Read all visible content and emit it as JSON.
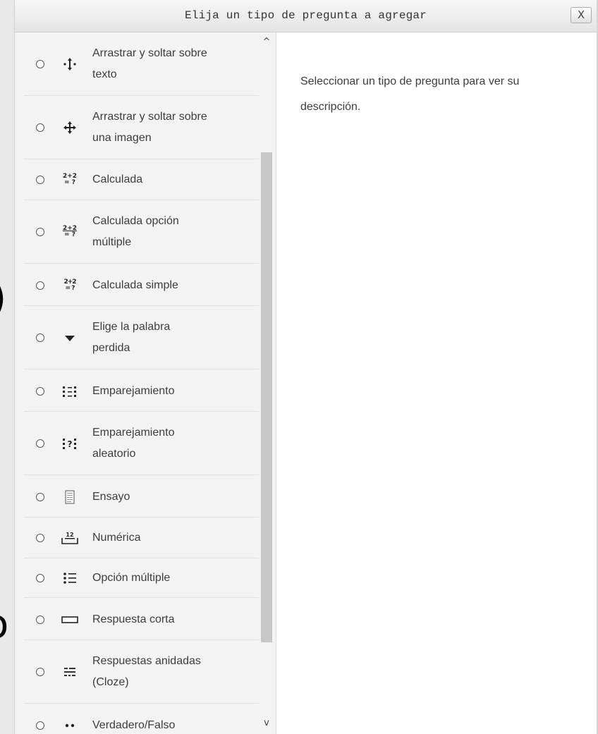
{
  "dialog": {
    "title": "Elija un tipo de pregunta a agregar",
    "close_label": "X"
  },
  "background_fragments": {
    "paren": ")",
    "letter": "o"
  },
  "question_types": [
    {
      "label_line1": "Arrastrar y soltar sobre",
      "label_line2": "texto",
      "icon": "drag-drop-text-icon"
    },
    {
      "label_line1": "Arrastrar y soltar sobre",
      "label_line2": "una imagen",
      "icon": "drag-drop-image-icon"
    },
    {
      "label_line1": "Calculada",
      "label_line2": "",
      "icon": "calculated-icon"
    },
    {
      "label_line1": "Calculada opción",
      "label_line2": "múltiple",
      "icon": "calculated-multichoice-icon"
    },
    {
      "label_line1": "Calculada simple",
      "label_line2": "",
      "icon": "calculated-simple-icon"
    },
    {
      "label_line1": "Elige la palabra",
      "label_line2": "perdida",
      "icon": "dropdown-triangle-icon"
    },
    {
      "label_line1": "Emparejamiento",
      "label_line2": "",
      "icon": "matching-icon"
    },
    {
      "label_line1": "Emparejamiento",
      "label_line2": "aleatorio",
      "icon": "random-matching-icon"
    },
    {
      "label_line1": "Ensayo",
      "label_line2": "",
      "icon": "essay-icon"
    },
    {
      "label_line1": "Numérica",
      "label_line2": "",
      "icon": "numerical-icon"
    },
    {
      "label_line1": "Opción múltiple",
      "label_line2": "",
      "icon": "multichoice-icon"
    },
    {
      "label_line1": "Respuesta corta",
      "label_line2": "",
      "icon": "short-answer-icon"
    },
    {
      "label_line1": "Respuestas anidadas",
      "label_line2": "(Cloze)",
      "icon": "cloze-icon"
    },
    {
      "label_line1": "Verdadero/Falso",
      "label_line2": "",
      "icon": "true-false-icon"
    }
  ],
  "icon_text": {
    "calc_top": "2+2",
    "calc_bottom": "= ?",
    "numerical": "12"
  },
  "description": {
    "text": "Seleccionar un tipo de pregunta para ver su descripción."
  },
  "scrollbar": {
    "up_arrow": "^",
    "down_arrow": "v"
  }
}
